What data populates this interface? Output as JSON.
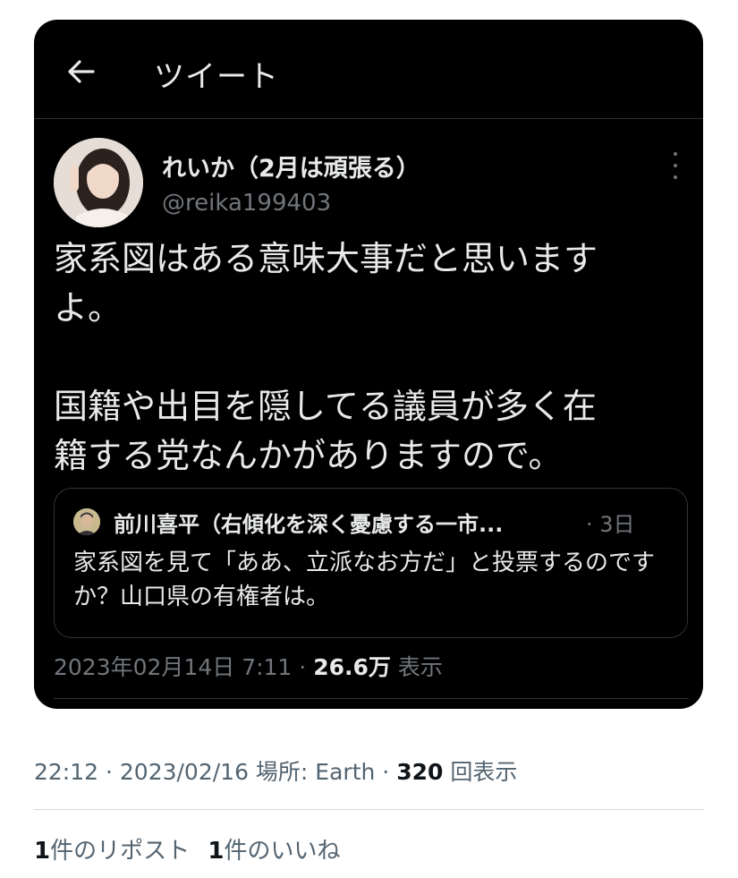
{
  "header": {
    "title": "ツイート"
  },
  "tweet": {
    "display_name": "れいか（2月は頑張る）",
    "handle": "@reika199403",
    "text": "家系図はある意味大事だと思います\nよ。\n\n国籍や出目を隠してる議員が多く在\n籍する党なんかがありますので。",
    "quote": {
      "author": "前川喜平（右傾化を深く憂慮する一市...",
      "time": "· 3日",
      "text": "家系図を見て「ああ、立派なお方だ」と投票するのですか？山口県の有権者は。"
    },
    "meta": {
      "datetime": "2023年02月14日 7:11 · ",
      "views_count": "26.6万",
      "views_label": " 表示"
    }
  },
  "post": {
    "meta_prefix": "22:12 · 2023/02/16 場所: Earth · ",
    "views_count": "320",
    "views_label": " 回表示",
    "reposts_count": "1",
    "reposts_label": "件のリポスト",
    "likes_count": "1",
    "likes_label": "件のいいね"
  },
  "colors": {
    "card_bg": "#000000",
    "text_primary": "#e7e9ea",
    "text_secondary": "#71767b",
    "border": "#2f3336"
  }
}
